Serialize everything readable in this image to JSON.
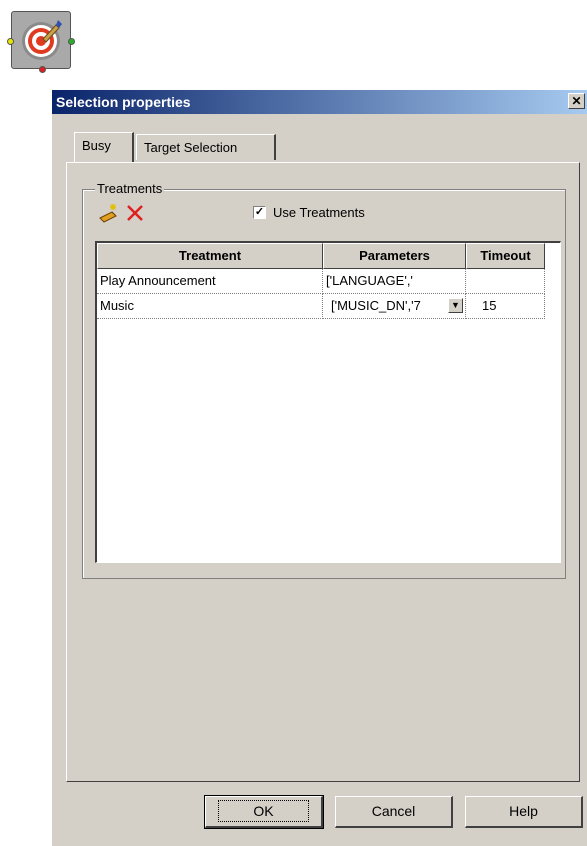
{
  "window": {
    "title": "Selection properties",
    "close_glyph": "✕"
  },
  "tabs": [
    {
      "label": "Busy",
      "active": true
    },
    {
      "label": "Target Selection",
      "active": false
    }
  ],
  "treatments": {
    "group_label": "Treatments",
    "toolbar": {
      "add_icon": "add-treatment-icon",
      "delete_icon": "delete-icon"
    },
    "use_treatments": {
      "label": "Use Treatments",
      "checked": true,
      "check_glyph": "✓"
    },
    "columns": [
      "Treatment",
      "Parameters",
      "Timeout"
    ],
    "rows": [
      {
        "treatment": "Play Announcement",
        "parameters": "['LANGUAGE','",
        "timeout": ""
      },
      {
        "treatment": "Music",
        "parameters": "['MUSIC_DN','7",
        "timeout": "15"
      }
    ]
  },
  "buttons": {
    "ok": "OK",
    "cancel": "Cancel",
    "help": "Help"
  },
  "colors": {
    "title_start": "#0a246a",
    "title_end": "#a6caf0",
    "face": "#d4d0c8"
  }
}
